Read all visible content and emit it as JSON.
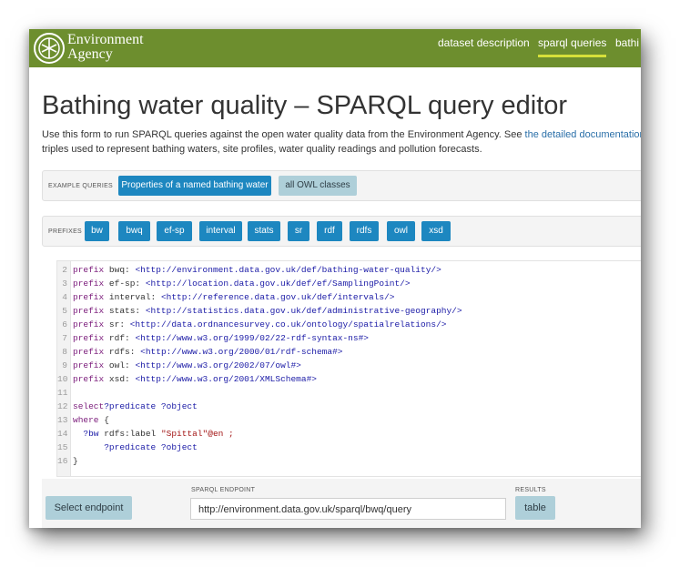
{
  "brand": {
    "line1": "Environment",
    "line2": "Agency"
  },
  "nav": {
    "items": [
      "dataset description",
      "sparql queries",
      "bathi"
    ]
  },
  "page_title": "Bathing water quality – SPARQL query editor",
  "intro": {
    "text1": "Use this form to run SPARQL queries against the open water quality data from the Environment Agency. See ",
    "link": "the detailed documentation",
    "text2": " t",
    "line2": "triples used to represent bathing waters, site profiles, water quality readings and pollution forecasts."
  },
  "example_queries": {
    "label": "EXAMPLE QUERIES",
    "buttons": [
      "Properties of a named bathing water",
      "all OWL classes"
    ]
  },
  "prefixes": {
    "label": "PREFIXES",
    "buttons": [
      "bw",
      "bwq",
      "ef-sp",
      "interval",
      "stats",
      "sr",
      "rdf",
      "rdfs",
      "owl",
      "xsd"
    ]
  },
  "editor": {
    "lines": [
      {
        "n": "2",
        "kw": "prefix",
        "name": " bwq: ",
        "uri": "<http://environment.data.gov.uk/def/bathing-water-quality/>"
      },
      {
        "n": "3",
        "kw": "prefix",
        "name": " ef-sp: ",
        "uri": "<http://location.data.gov.uk/def/ef/SamplingPoint/>"
      },
      {
        "n": "4",
        "kw": "prefix",
        "name": " interval: ",
        "uri": "<http://reference.data.gov.uk/def/intervals/>"
      },
      {
        "n": "5",
        "kw": "prefix",
        "name": " stats: ",
        "uri": "<http://statistics.data.gov.uk/def/administrative-geography/>"
      },
      {
        "n": "6",
        "kw": "prefix",
        "name": " sr: ",
        "uri": "<http://data.ordnancesurvey.co.uk/ontology/spatialrelations/>"
      },
      {
        "n": "7",
        "kw": "prefix",
        "name": " rdf: ",
        "uri": "<http://www.w3.org/1999/02/22-rdf-syntax-ns#>"
      },
      {
        "n": "8",
        "kw": "prefix",
        "name": " rdfs: ",
        "uri": "<http://www.w3.org/2000/01/rdf-schema#>"
      },
      {
        "n": "9",
        "kw": "prefix",
        "name": " owl: ",
        "uri": "<http://www.w3.org/2002/07/owl#>"
      },
      {
        "n": "10",
        "kw": "prefix",
        "name": " xsd: ",
        "uri": "<http://www.w3.org/2001/XMLSchema#>"
      },
      {
        "n": "11",
        "kw": "",
        "name": "",
        "uri": ""
      },
      {
        "n": "12",
        "kw": "select",
        "name": " ",
        "uri": "?predicate ?object"
      },
      {
        "n": "13",
        "kw": "where",
        "name": " {",
        "uri": ""
      },
      {
        "n": "14",
        "kw": "  ?bw",
        "name": " rdfs:label ",
        "uri": "\"Spittal\"@en ;"
      },
      {
        "n": "15",
        "kw": "",
        "name": "      ",
        "uri": "?predicate ?object"
      },
      {
        "n": "16",
        "kw": "",
        "name": "}",
        "uri": ""
      }
    ]
  },
  "footer": {
    "select_endpoint": "Select endpoint",
    "endpoint_label": "SPARQL ENDPOINT",
    "endpoint_value": "http://environment.data.gov.uk/sparql/bwq/query",
    "results_label": "RESULTS",
    "results_button": "table"
  },
  "colors": {
    "header_green": "#6d8e2e",
    "button_blue": "#1d87c0",
    "nav_underline": "#d6e03a"
  }
}
